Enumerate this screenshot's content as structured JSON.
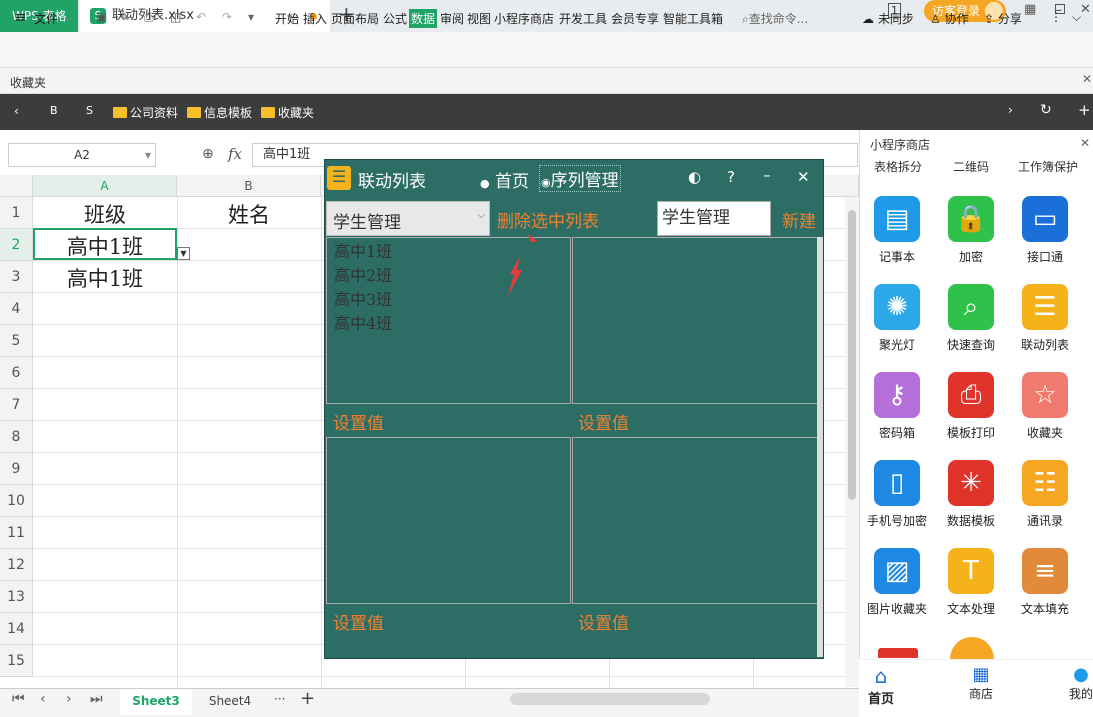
{
  "titlebar": {
    "app_name": "WPS 表格",
    "file_name": "联动列表.xlsx",
    "new_tab": "+",
    "login": "访客登录"
  },
  "menu": {
    "file": "文件",
    "items": [
      "开始",
      "插入",
      "页面布局",
      "公式",
      "数据",
      "审阅",
      "视图",
      "小程序商店",
      "开发工具",
      "会员专享",
      "智能工具箱"
    ],
    "search": "查找命令...",
    "sync": "未同步",
    "collab": "协作",
    "share": "分享"
  },
  "favorites": {
    "label": "收藏夹"
  },
  "bookmarks": {
    "b": "B",
    "s": "S",
    "folders": [
      "公司资料",
      "信息模板",
      "收藏夹"
    ]
  },
  "sheet": {
    "name_box": "A2",
    "fx": "fx",
    "formula_value": "高中1班",
    "columns": [
      "A",
      "B"
    ],
    "rows": [
      "1",
      "2",
      "3",
      "4",
      "5",
      "6",
      "7",
      "8",
      "9",
      "10",
      "11",
      "12",
      "13",
      "14",
      "15"
    ],
    "cells": {
      "a1": "班级",
      "b1": "姓名",
      "a2": "高中1班",
      "a3": "高中1班"
    },
    "tabs": [
      "Sheet3",
      "Sheet4"
    ],
    "more": "···",
    "add": "+"
  },
  "dialog": {
    "title": "联动列表",
    "radio_home": "首页",
    "radio_seq": "序列管理",
    "help": "?",
    "minimize": "–",
    "close": "✕",
    "dropdown_value": "学生管理",
    "delete_btn": "删除选中列表",
    "new_input": "学生管理",
    "new_btn": "新建",
    "list_items": [
      "高中1班",
      "高中2班",
      "高中3班",
      "高中4班"
    ],
    "set_value": "设置值"
  },
  "rpanel": {
    "title": "小程序商店",
    "top_items": [
      "表格拆分",
      "二维码",
      "工作簿保护"
    ],
    "apps": [
      {
        "label": "记事本",
        "icon": "notepad-icon",
        "color": "#1e9be8"
      },
      {
        "label": "加密",
        "icon": "lock-icon",
        "color": "#2fc24a"
      },
      {
        "label": "接口通",
        "icon": "monitor-icon",
        "color": "#1b6fd8"
      },
      {
        "label": "聚光灯",
        "icon": "bulb-icon",
        "color": "#2aa8e8"
      },
      {
        "label": "快速查询",
        "icon": "search-icon",
        "color": "#2fc24a"
      },
      {
        "label": "联动列表",
        "icon": "list-icon",
        "color": "#f6b21b"
      },
      {
        "label": "密码箱",
        "icon": "key-icon",
        "color": "#b46fd8"
      },
      {
        "label": "模板打印",
        "icon": "printer-icon",
        "color": "#e0342b"
      },
      {
        "label": "收藏夹",
        "icon": "star-icon",
        "color": "#f07a6e"
      },
      {
        "label": "手机号加密",
        "icon": "phone-icon",
        "color": "#1e88e5"
      },
      {
        "label": "数据模板",
        "icon": "network-icon",
        "color": "#e0342b"
      },
      {
        "label": "通讯录",
        "icon": "contacts-icon",
        "color": "#f5a623"
      },
      {
        "label": "图片收藏夹",
        "icon": "image-icon",
        "color": "#1e88e5"
      },
      {
        "label": "文本处理",
        "icon": "text-icon",
        "color": "#f6b21b"
      },
      {
        "label": "文本填充",
        "icon": "doc-icon",
        "color": "#e08a3a"
      }
    ],
    "nav": [
      "首页",
      "商店",
      "我的"
    ]
  }
}
